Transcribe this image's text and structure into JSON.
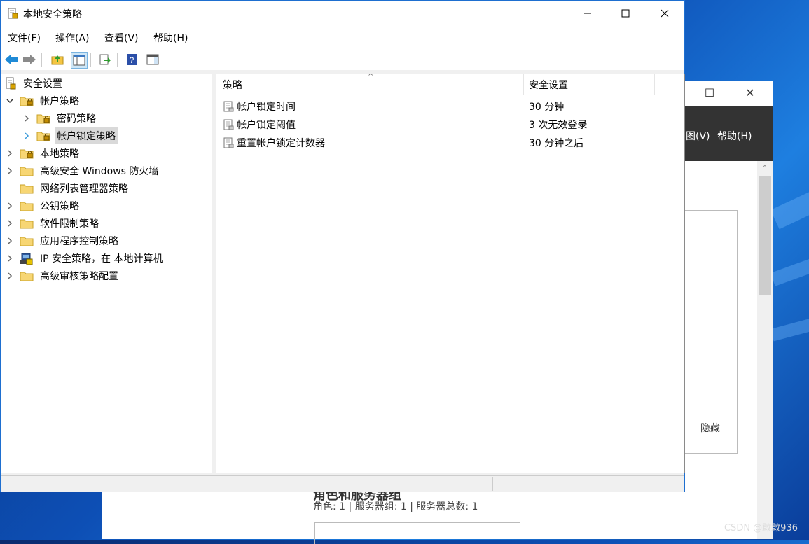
{
  "main_window": {
    "title": "本地安全策略",
    "menu": [
      "文件(F)",
      "操作(A)",
      "查看(V)",
      "帮助(H)"
    ],
    "tree": [
      {
        "label": "安全设置",
        "icon": "security-settings-icon",
        "expand": "none",
        "level": 0
      },
      {
        "label": "帐户策略",
        "icon": "folder-lock-icon",
        "expand": "expanded",
        "level": 1
      },
      {
        "label": "密码策略",
        "icon": "folder-lock-icon",
        "expand": "collapsed",
        "level": 2
      },
      {
        "label": "帐户锁定策略",
        "icon": "folder-lock-icon",
        "expand": "collapsed",
        "level": 2,
        "selected": true
      },
      {
        "label": "本地策略",
        "icon": "folder-lock-icon",
        "expand": "collapsed",
        "level": 1
      },
      {
        "label": "高级安全 Windows 防火墙",
        "icon": "folder-icon",
        "expand": "collapsed",
        "level": 1
      },
      {
        "label": "网络列表管理器策略",
        "icon": "folder-icon",
        "expand": "none",
        "level": 1
      },
      {
        "label": "公钥策略",
        "icon": "folder-icon",
        "expand": "collapsed",
        "level": 1
      },
      {
        "label": "软件限制策略",
        "icon": "folder-icon",
        "expand": "collapsed",
        "level": 1
      },
      {
        "label": "应用程序控制策略",
        "icon": "folder-icon",
        "expand": "collapsed",
        "level": 1
      },
      {
        "label": "IP 安全策略，在 本地计算机",
        "icon": "ip-security-icon",
        "expand": "collapsed",
        "level": 1
      },
      {
        "label": "高级审核策略配置",
        "icon": "folder-icon",
        "expand": "collapsed",
        "level": 1
      }
    ],
    "list": {
      "columns": [
        "策略",
        "安全设置"
      ],
      "rows": [
        {
          "policy": "帐户锁定时间",
          "setting": "30 分钟"
        },
        {
          "policy": "帐户锁定阈值",
          "setting": "3 次无效登录"
        },
        {
          "policy": "重置帐户锁定计数器",
          "setting": "30 分钟之后"
        }
      ]
    }
  },
  "background_window": {
    "menu_partial": "图(V)",
    "menu_help": "帮助(H)",
    "hide_label": "隐藏",
    "role_title": "角色和服务器组",
    "role_stats": "角色: 1 | 服务器组: 1 | 服务器总数: 1"
  },
  "watermark": "CSDN @敢敢936"
}
